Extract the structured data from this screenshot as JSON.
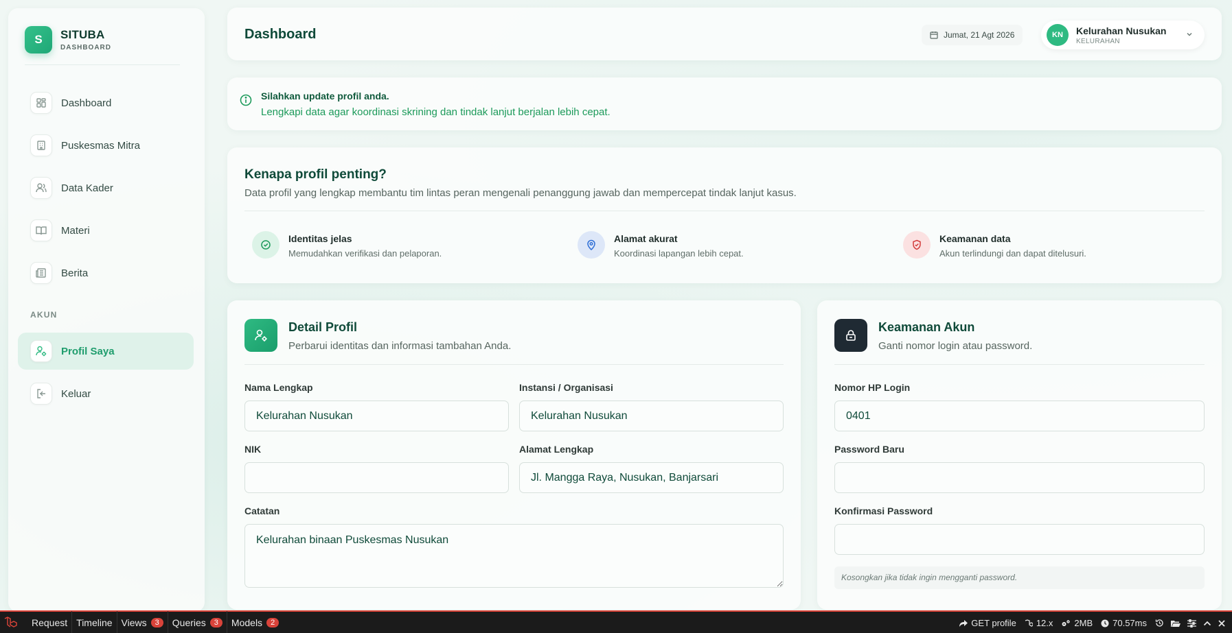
{
  "brand": {
    "logo_letter": "S",
    "name": "SITUBA",
    "subtitle": "DASHBOARD"
  },
  "sidebar": {
    "items": [
      {
        "label": "Dashboard",
        "icon": "grid-icon"
      },
      {
        "label": "Puskesmas Mitra",
        "icon": "building-icon"
      },
      {
        "label": "Data Kader",
        "icon": "users-icon"
      },
      {
        "label": "Materi",
        "icon": "book-icon"
      },
      {
        "label": "Berita",
        "icon": "newspaper-icon"
      }
    ],
    "section_label": "AKUN",
    "account_items": [
      {
        "label": "Profil Saya",
        "icon": "user-gear-icon",
        "active": true
      },
      {
        "label": "Keluar",
        "icon": "logout-icon"
      }
    ]
  },
  "header": {
    "title": "Dashboard",
    "date": "Jumat, 21 Agt 2026",
    "user": {
      "initials": "KN",
      "name": "Kelurahan Nusukan",
      "role": "KELURAHAN"
    }
  },
  "alert": {
    "title": "Silahkan update profil anda.",
    "message": "Lengkapi data agar koordinasi skrining dan tindak lanjut berjalan lebih cepat."
  },
  "why": {
    "title": "Kenapa profil penting?",
    "description": "Data profil yang lengkap membantu tim lintas peran mengenali penanggung jawab dan mempercepat tindak lanjut kasus.",
    "features": [
      {
        "title": "Identitas jelas",
        "subtitle": "Memudahkan verifikasi dan pelaporan."
      },
      {
        "title": "Alamat akurat",
        "subtitle": "Koordinasi lapangan lebih cepat."
      },
      {
        "title": "Keamanan data",
        "subtitle": "Akun terlindungi dan dapat ditelusuri."
      }
    ]
  },
  "profile": {
    "title": "Detail Profil",
    "description": "Perbarui identitas dan informasi tambahan Anda.",
    "fields": {
      "nama": {
        "label": "Nama Lengkap",
        "value": "Kelurahan Nusukan"
      },
      "instansi": {
        "label": "Instansi / Organisasi",
        "value": "Kelurahan Nusukan"
      },
      "nik": {
        "label": "NIK",
        "value": ""
      },
      "alamat": {
        "label": "Alamat Lengkap",
        "value": "Jl. Mangga Raya, Nusukan, Banjarsari"
      },
      "catatan": {
        "label": "Catatan",
        "value": "Kelurahan binaan Puskesmas Nusukan"
      }
    }
  },
  "security": {
    "title": "Keamanan Akun",
    "description": "Ganti nomor login atau password.",
    "fields": {
      "phone": {
        "label": "Nomor HP Login",
        "value": "0401"
      },
      "password": {
        "label": "Password Baru",
        "value": ""
      },
      "confirm": {
        "label": "Konfirmasi Password",
        "value": ""
      }
    },
    "hint": "Kosongkan jika tidak ingin mengganti password."
  },
  "debugbar": {
    "tabs": [
      {
        "label": "Request"
      },
      {
        "label": "Timeline"
      },
      {
        "label": "Views",
        "badge": "3"
      },
      {
        "label": "Queries",
        "badge": "3"
      },
      {
        "label": "Models",
        "badge": "2"
      }
    ],
    "request": "GET profile",
    "version": "12.x",
    "memory": "2MB",
    "time": "70.57ms"
  },
  "colors": {
    "accent": "#2fba82",
    "accent_dark": "#0f4a39",
    "alert_text": "#1c9a5a",
    "danger": "#d9433a"
  }
}
